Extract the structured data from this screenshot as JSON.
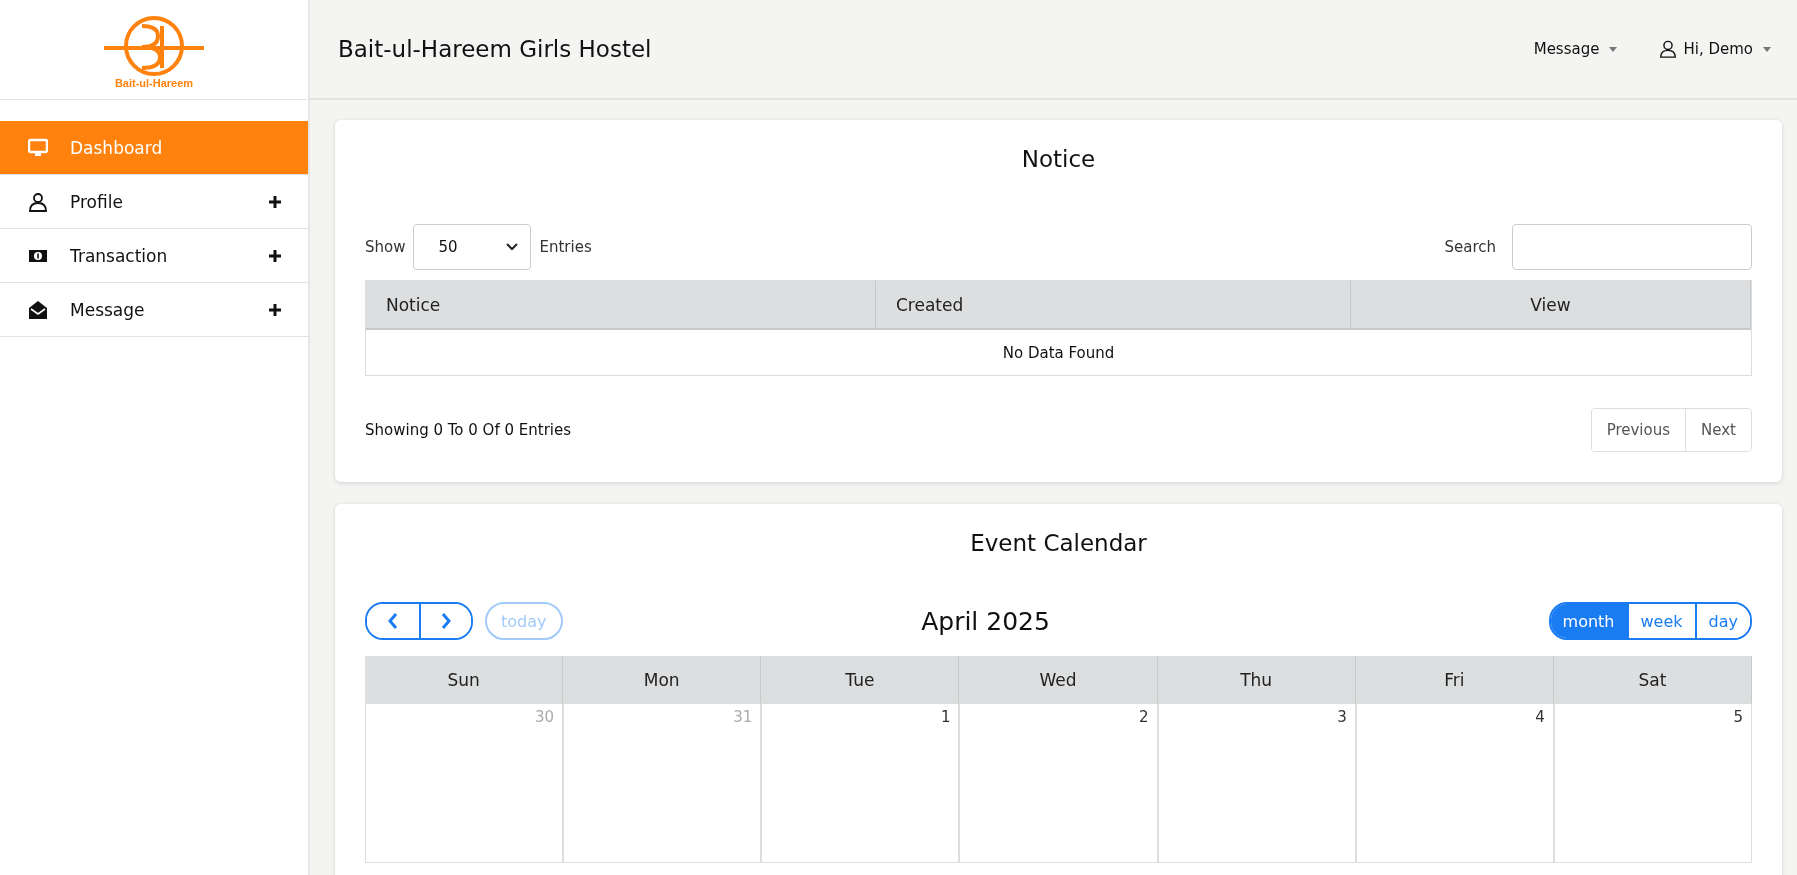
{
  "logo": {
    "text": "Bait-ul-Hareem"
  },
  "sidebar": {
    "items": [
      {
        "kind": "monitor",
        "label": "Dashboard",
        "selected": true,
        "expandable": false
      },
      {
        "kind": "user",
        "label": "Profile",
        "selected": false,
        "expandable": true
      },
      {
        "kind": "money",
        "label": "Transaction",
        "selected": false,
        "expandable": true
      },
      {
        "kind": "envelope",
        "label": "Message",
        "selected": false,
        "expandable": true
      }
    ]
  },
  "header": {
    "title": "Bait-ul-Hareem Girls Hostel",
    "menus": [
      {
        "kind": "plain",
        "label": "Message"
      },
      {
        "kind": "user",
        "label": "Hi, Demo"
      }
    ]
  },
  "notice": {
    "title": "Notice",
    "show_label": "Show",
    "page_size": "50",
    "entries_label": "Entries",
    "search_label": "Search",
    "columns": [
      "Notice",
      "Created",
      "View"
    ],
    "empty_text": "No Data Found",
    "info": "Showing 0 To 0 Of 0 Entries",
    "pagination": [
      {
        "label": "Previous"
      },
      {
        "label": "Next"
      }
    ]
  },
  "calendar": {
    "title": "Event Calendar",
    "today_label": "today",
    "today_disabled": true,
    "month": "April 2025",
    "views": [
      {
        "label": "month",
        "selected": true
      },
      {
        "label": "week",
        "selected": false
      },
      {
        "label": "day",
        "selected": false
      }
    ],
    "weekdays": [
      "Sun",
      "Mon",
      "Tue",
      "Wed",
      "Thu",
      "Fri",
      "Sat"
    ],
    "days": [
      {
        "label": "30",
        "other_month": true
      },
      {
        "label": "31",
        "other_month": true
      },
      {
        "label": "1",
        "other_month": false
      },
      {
        "label": "2",
        "other_month": false
      },
      {
        "label": "3",
        "other_month": false
      },
      {
        "label": "4",
        "other_month": false
      },
      {
        "label": "5",
        "other_month": false
      }
    ]
  }
}
